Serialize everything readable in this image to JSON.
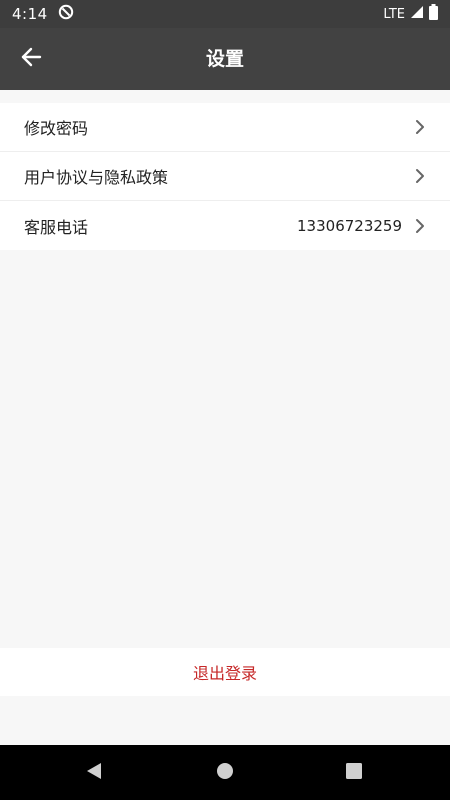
{
  "status_bar": {
    "time": "4:14",
    "network": "LTE",
    "icons": [
      "do-not-disturb-icon",
      "signal-icon",
      "battery-icon"
    ]
  },
  "app_bar": {
    "title": "设置",
    "back_icon": "arrow-left-icon"
  },
  "settings": {
    "items": [
      {
        "label": "修改密码",
        "value": ""
      },
      {
        "label": "用户协议与隐私政策",
        "value": ""
      },
      {
        "label": "客服电话",
        "value": "13306723259"
      }
    ],
    "chevron_icon": "chevron-right-icon"
  },
  "logout": {
    "label": "退出登录",
    "color": "#c62828"
  },
  "nav_bar": {
    "icons": [
      "back-triangle-icon",
      "home-circle-icon",
      "recents-square-icon"
    ]
  },
  "colors": {
    "app_bar": "#424242",
    "status_bar": "#3d3d3d",
    "background": "#f7f7f7"
  }
}
